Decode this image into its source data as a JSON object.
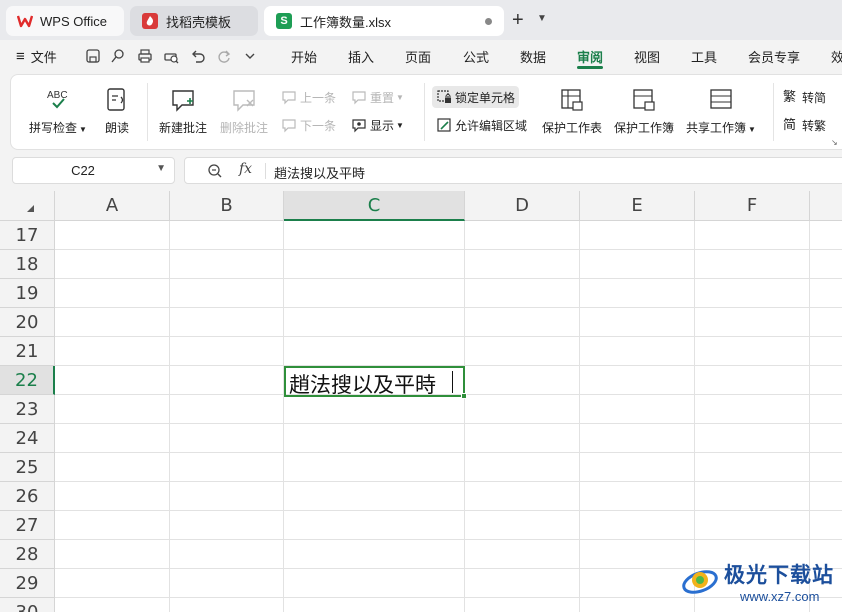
{
  "tabs": {
    "home": "WPS Office",
    "template": "找稻壳模板",
    "workbook": "工作簿数量.xlsx"
  },
  "menubar": {
    "hamburger": "≡",
    "file": "文件",
    "tabs": [
      "开始",
      "插入",
      "页面",
      "公式",
      "数据",
      "审阅",
      "视图",
      "工具",
      "会员专享",
      "效"
    ],
    "active_tab": "审阅"
  },
  "ribbon": {
    "spell_check": "拼写检查",
    "read_aloud": "朗读",
    "new_comment": "新建批注",
    "delete_comment": "删除批注",
    "prev": "上一条",
    "next": "下一条",
    "reset": "重置",
    "show": "显示",
    "lock_cell": "锁定单元格",
    "allow_edit_range": "允许编辑区域",
    "protect_sheet": "保护工作表",
    "protect_workbook": "保护工作簿",
    "share_workbook": "共享工作簿",
    "to_simplified": "转简",
    "to_traditional": "转繁",
    "abc": "ABC"
  },
  "formula_bar": {
    "cell_ref": "C22",
    "fx": "fx",
    "value": "趙法搜以及平時"
  },
  "grid": {
    "columns": [
      "A",
      "B",
      "C",
      "D",
      "E",
      "F"
    ],
    "selected_column": "C",
    "rows": [
      "17",
      "18",
      "19",
      "20",
      "21",
      "22",
      "23",
      "24",
      "25",
      "26",
      "27",
      "28",
      "29",
      "30"
    ],
    "selected_row": "22",
    "active_cell_value": "趙法搜以及平時"
  },
  "watermark": {
    "title": "极光下载站",
    "url": "www.xz7.com"
  },
  "colors": {
    "accent": "#1b7f4b",
    "active_cell_border": "#2f8f3a",
    "wps_red": "#e02b2b",
    "sheet_green": "#1e9e55"
  }
}
